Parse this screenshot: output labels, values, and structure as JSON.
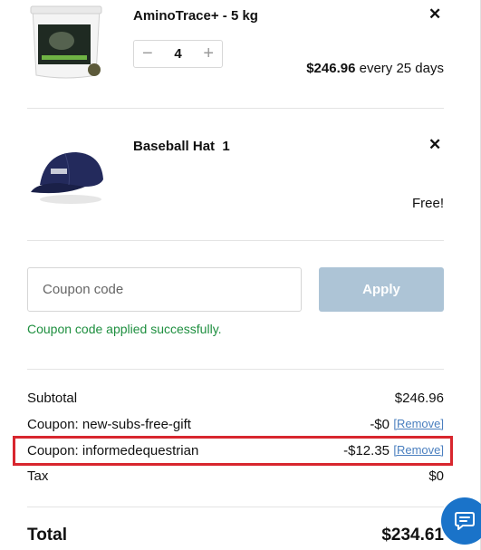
{
  "cart": {
    "items": [
      {
        "name": "AminoTrace+ - 5 kg",
        "quantity": "4",
        "price": "$246.96",
        "frequency": "every 25 days",
        "image": "supplement-bucket-image"
      },
      {
        "name": "Baseball Hat",
        "quantity": "1",
        "price": "Free!",
        "image": "baseball-hat-image"
      }
    ],
    "remove_symbol": "✕",
    "qty_minus": "−",
    "qty_plus": "+"
  },
  "coupon": {
    "placeholder": "Coupon code",
    "apply_label": "Apply",
    "success_message": "Coupon code applied successfully."
  },
  "summary": {
    "subtotal_label": "Subtotal",
    "subtotal_value": "$246.96",
    "coupons": [
      {
        "label": "Coupon: new-subs-free-gift",
        "value": "-$0",
        "remove_label": "[Remove]"
      },
      {
        "label": "Coupon: informedequestrian",
        "value": "-$12.35",
        "remove_label": "[Remove]"
      }
    ],
    "tax_label": "Tax",
    "tax_value": "$0",
    "total_label": "Total",
    "total_value": "$234.61"
  },
  "colors": {
    "apply_button": "#adc4d6",
    "success_text": "#1e8f3f",
    "highlight_border": "#d8262e",
    "chat_button": "#1a73c9",
    "link": "#4a7fbf"
  }
}
